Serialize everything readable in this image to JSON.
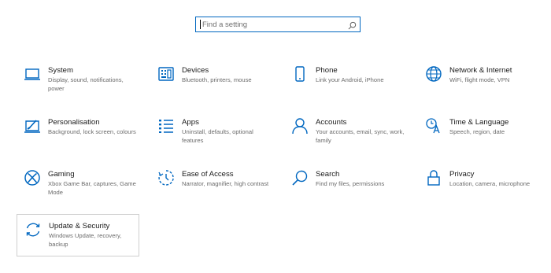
{
  "search": {
    "placeholder": "Find a setting"
  },
  "accent_color": "#0067c0",
  "tiles": [
    {
      "icon": "laptop-icon",
      "title": "System",
      "desc": "Display, sound, notifications, power"
    },
    {
      "icon": "keyboard-icon",
      "title": "Devices",
      "desc": "Bluetooth, printers, mouse"
    },
    {
      "icon": "phone-icon",
      "title": "Phone",
      "desc": "Link your Android, iPhone"
    },
    {
      "icon": "globe-icon",
      "title": "Network & Internet",
      "desc": "WiFi, flight mode, VPN"
    },
    {
      "icon": "paintbrush-icon",
      "title": "Personalisation",
      "desc": "Background, lock screen, colours"
    },
    {
      "icon": "apps-list-icon",
      "title": "Apps",
      "desc": "Uninstall, defaults, optional features"
    },
    {
      "icon": "person-icon",
      "title": "Accounts",
      "desc": "Your accounts, email, sync, work, family"
    },
    {
      "icon": "language-icon",
      "title": "Time & Language",
      "desc": "Speech, region, date"
    },
    {
      "icon": "xbox-icon",
      "title": "Gaming",
      "desc": "Xbox Game Bar, captures, Game Mode"
    },
    {
      "icon": "ease-of-access-icon",
      "title": "Ease of Access",
      "desc": "Narrator, magnifier, high contrast"
    },
    {
      "icon": "search-icon",
      "title": "Search",
      "desc": "Find my files, permissions"
    },
    {
      "icon": "lock-icon",
      "title": "Privacy",
      "desc": "Location, camera, microphone"
    },
    {
      "icon": "sync-icon",
      "title": "Update & Security",
      "desc": "Windows Update, recovery, backup"
    }
  ]
}
